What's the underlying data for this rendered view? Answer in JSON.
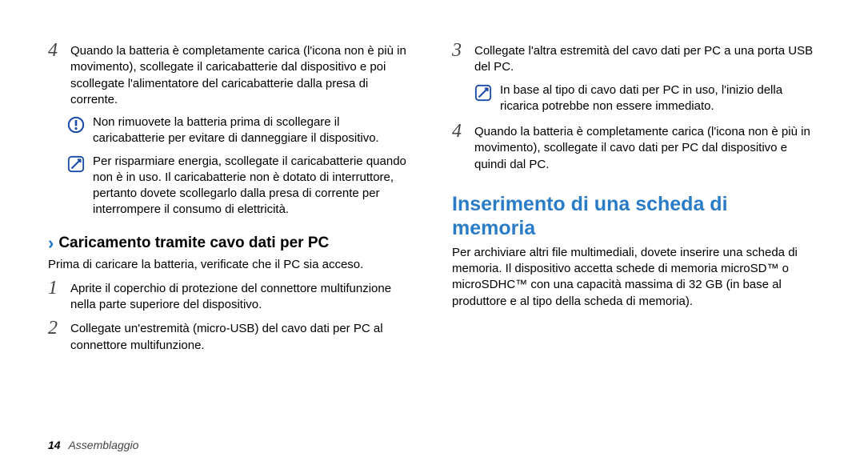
{
  "left": {
    "step4": {
      "num": "4",
      "text": "Quando la batteria è completamente carica (l'icona non è più in movimento), scollegate il caricabatterie dal dispositivo e poi scollegate l'alimentatore del caricabatterie dalla presa di corrente."
    },
    "warn": "Non rimuovete la batteria prima di scollegare il caricabatterie per evitare di danneggiare il dispositivo.",
    "tip": "Per risparmiare energia, scollegate il caricabatterie quando non è in uso. Il caricabatterie non è dotato di interruttore, pertanto dovete scollegarlo dalla presa di corrente per interrompere il consumo di elettricità.",
    "subhead": "Caricamento tramite cavo dati per PC",
    "intro": "Prima di caricare la batteria, verificate che il PC sia acceso.",
    "step1": {
      "num": "1",
      "text": "Aprite il coperchio di protezione del connettore multifunzione nella parte superiore del dispositivo."
    },
    "step2": {
      "num": "2",
      "text": "Collegate un'estremità (micro-USB) del cavo dati per PC al connettore multifunzione."
    }
  },
  "right": {
    "step3": {
      "num": "3",
      "text": "Collegate l'altra estremità del cavo dati per PC a una porta USB del PC."
    },
    "tip": "In base al tipo di cavo dati per PC in uso, l'inizio della ricarica potrebbe non essere immediato.",
    "step4": {
      "num": "4",
      "text": "Quando la batteria è completamente carica (l'icona non è più in movimento), scollegate il cavo dati per PC dal dispositivo e quindi dal PC."
    },
    "h2": "Inserimento di una scheda di memoria",
    "body": "Per archiviare altri file multimediali, dovete inserire una scheda di memoria. Il dispositivo accetta schede di memoria microSD™ o microSDHC™ con una capacità massima di 32 GB (in base al produttore e al tipo della scheda di memoria)."
  },
  "footer": {
    "page": "14",
    "section": "Assemblaggio"
  }
}
